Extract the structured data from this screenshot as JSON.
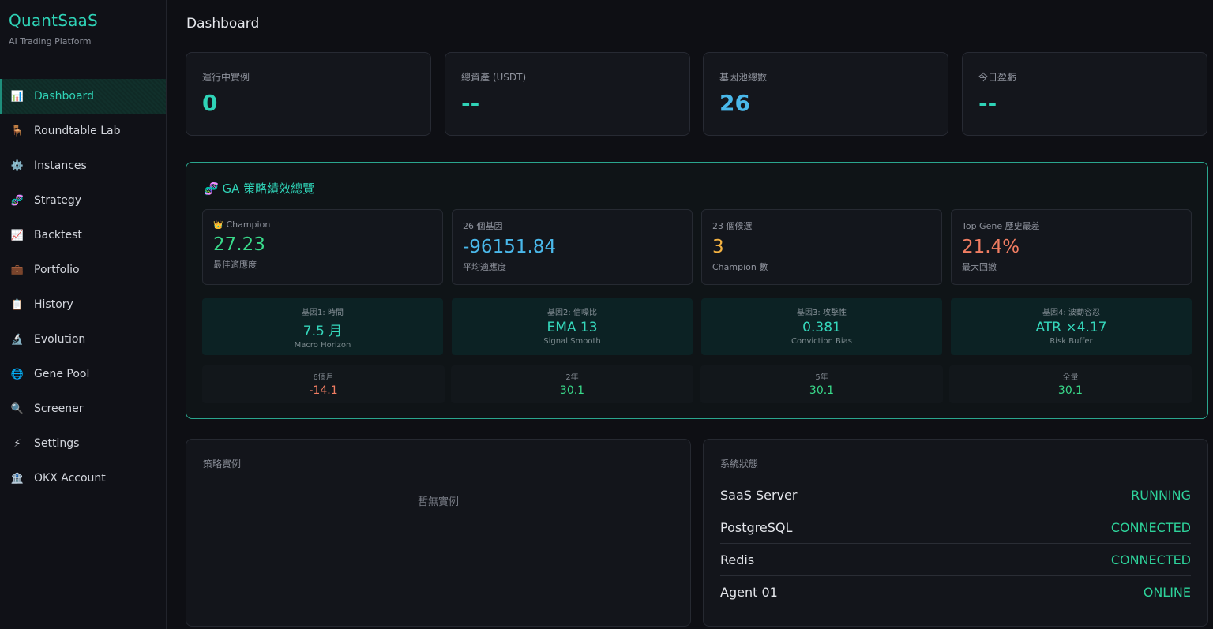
{
  "brand": {
    "name": "QuantSaaS",
    "subtitle": "AI Trading Platform"
  },
  "sidebar": {
    "items": [
      {
        "label": "Dashboard",
        "icon": "bar-chart-icon",
        "glyph": "📊",
        "active": true
      },
      {
        "label": "Roundtable Lab",
        "icon": "chair-icon",
        "glyph": "🪑"
      },
      {
        "label": "Instances",
        "icon": "gear-icon",
        "glyph": "⚙️"
      },
      {
        "label": "Strategy",
        "icon": "dna-icon",
        "glyph": "🧬"
      },
      {
        "label": "Backtest",
        "icon": "line-chart-icon",
        "glyph": "📈"
      },
      {
        "label": "Portfolio",
        "icon": "briefcase-icon",
        "glyph": "💼"
      },
      {
        "label": "History",
        "icon": "clipboard-icon",
        "glyph": "📋"
      },
      {
        "label": "Evolution",
        "icon": "microscope-icon",
        "glyph": "🔬"
      },
      {
        "label": "Gene Pool",
        "icon": "globe-icon",
        "glyph": "🌐"
      },
      {
        "label": "Screener",
        "icon": "magnifier-icon",
        "glyph": "🔍"
      },
      {
        "label": "Settings",
        "icon": "lightning-icon",
        "glyph": "⚡"
      },
      {
        "label": "OKX Account",
        "icon": "bank-icon",
        "glyph": "🏦"
      }
    ]
  },
  "header": {
    "title": "Dashboard"
  },
  "stats": [
    {
      "label": "運行中實例",
      "value": "0",
      "color": "#2fd3b7"
    },
    {
      "label": "總資產 (USDT)",
      "value": "--",
      "color": "#2fd3b7"
    },
    {
      "label": "基因池總數",
      "value": "26",
      "color": "#4ab8ea"
    },
    {
      "label": "今日盈虧",
      "value": "--",
      "color": "#2fd3b7"
    }
  ],
  "ga": {
    "title": "GA 策略績效總覽",
    "title_icon": "🧬",
    "cards": [
      {
        "label": "Champion",
        "label_icon": "👑",
        "value": "27.23",
        "sub": "最佳適應度",
        "color": "#39d98a"
      },
      {
        "label": "26 個基因",
        "value": "-96151.84",
        "sub": "平均適應度",
        "color": "#4ab8ea"
      },
      {
        "label": "23 個候選",
        "value": "3",
        "sub": "Champion 數",
        "color": "#f5b342"
      },
      {
        "label": "Top Gene 歷史最差",
        "value": "21.4%",
        "sub": "最大回撤",
        "color": "#f07d62"
      }
    ],
    "genes": [
      {
        "label": "基因1: 時間",
        "value": "7.5 月",
        "sub": "Macro Horizon"
      },
      {
        "label": "基因2: 信噪比",
        "value": "EMA 13",
        "sub": "Signal Smooth"
      },
      {
        "label": "基因3: 攻擊性",
        "value": "0.381",
        "sub": "Conviction Bias"
      },
      {
        "label": "基因4: 波動容忍",
        "value": "ATR ×4.17",
        "sub": "Risk Buffer"
      }
    ],
    "periods": [
      {
        "label": "6個月",
        "value": "-14.1",
        "color": "#f07d62"
      },
      {
        "label": "2年",
        "value": "30.1",
        "color": "#39d98a"
      },
      {
        "label": "5年",
        "value": "30.1",
        "color": "#39d98a"
      },
      {
        "label": "全量",
        "value": "30.1",
        "color": "#39d98a"
      }
    ]
  },
  "instances_panel": {
    "title": "策略實例",
    "empty": "暫無實例"
  },
  "system_panel": {
    "title": "系統狀態",
    "rows": [
      {
        "name": "SaaS Server",
        "status": "RUNNING"
      },
      {
        "name": "PostgreSQL",
        "status": "CONNECTED"
      },
      {
        "name": "Redis",
        "status": "CONNECTED"
      },
      {
        "name": "Agent 01",
        "status": "ONLINE"
      }
    ]
  }
}
